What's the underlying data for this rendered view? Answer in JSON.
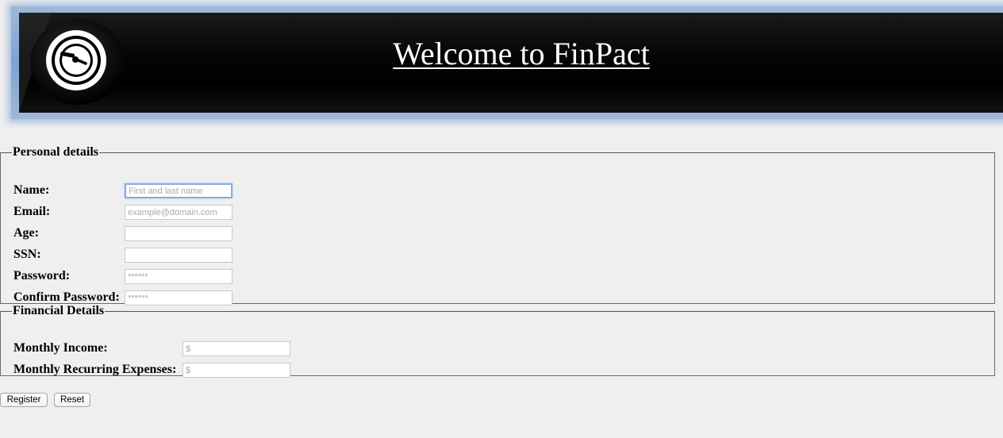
{
  "header": {
    "title": "Welcome to FinPact",
    "logo_icon": "clock-icon"
  },
  "personal": {
    "legend": "Personal details",
    "fields": [
      {
        "label": "Name:",
        "placeholder": "First and last name",
        "value": "",
        "focused": true
      },
      {
        "label": "Email:",
        "placeholder": "example@domain.com",
        "value": ""
      },
      {
        "label": "Age:",
        "placeholder": "",
        "value": ""
      },
      {
        "label": "SSN:",
        "placeholder": "",
        "value": ""
      },
      {
        "label": "Password:",
        "placeholder": "******",
        "value": ""
      },
      {
        "label": "Confirm Password:",
        "placeholder": "******",
        "value": ""
      }
    ]
  },
  "financial": {
    "legend": "Financial Details",
    "fields": [
      {
        "label": "Monthly Income:",
        "placeholder": "$",
        "value": ""
      },
      {
        "label": "Monthly Recurring Expenses:",
        "placeholder": "$",
        "value": ""
      }
    ]
  },
  "buttons": {
    "register_label": "Register",
    "reset_label": "Reset"
  },
  "colors": {
    "background": "#efefef",
    "banner": "#000000",
    "banner_glow": "#7da3d4",
    "focus_ring": "#84aee0"
  }
}
